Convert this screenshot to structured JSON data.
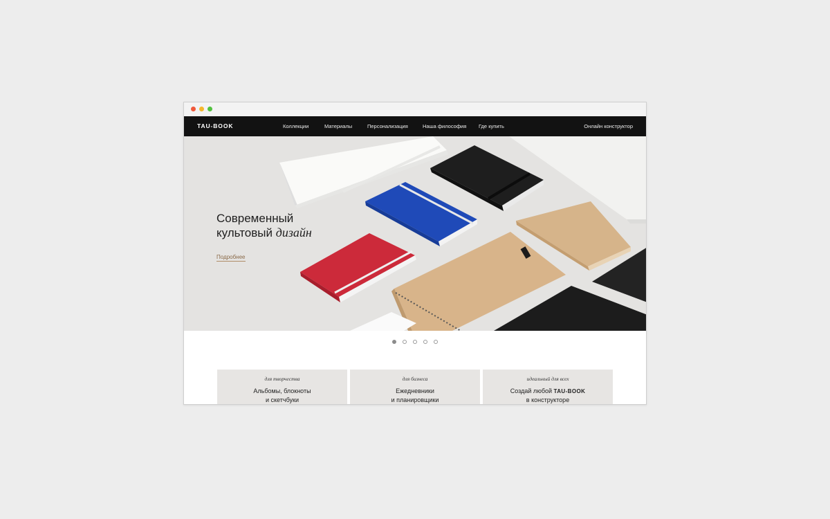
{
  "colors": {
    "accent_link": "#8a6a48",
    "navbar_bg": "#121212",
    "card_bg": "#e7e5e3"
  },
  "brand": {
    "logo": "TAU-BOOK"
  },
  "nav": {
    "items": [
      "Коллекции",
      "Материалы",
      "Персонализация",
      "Наша философия",
      "Где купить"
    ],
    "cta": "Онлайн конструктор"
  },
  "hero": {
    "title_line1": "Современный",
    "title_line2_plain": "культовый ",
    "title_line2_accent": "дизайн",
    "link": "Подробнее"
  },
  "slider": {
    "count": 5,
    "active_index": 0
  },
  "cards": [
    {
      "tag": "для творчества",
      "title_line1": "Альбомы, блокноты",
      "title_line2": "и скетчбуки"
    },
    {
      "tag": "для бизнеса",
      "title_line1": "Ежедневники",
      "title_line2": "и планировщики"
    },
    {
      "tag": "идеальный для всех",
      "title_line1_prefix": "Создай любой ",
      "title_line1_brand": "TAU-BOOK",
      "title_line2": "в конструкторе"
    }
  ],
  "icons": {
    "window_controls": [
      "close-dot-icon",
      "minimize-dot-icon",
      "maximize-dot-icon"
    ]
  }
}
